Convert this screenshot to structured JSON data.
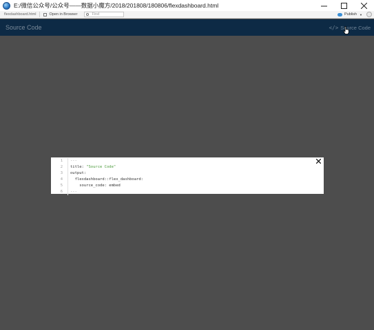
{
  "window": {
    "title": "E:/微信公众号/公众号——数据小魔方/2018/201808/180806/flexdashboard.html",
    "controls": {
      "minimize": "─",
      "close": "✕"
    }
  },
  "toolbar": {
    "file_tab": "flexdashboard.html",
    "open_in_browser": "Open in Browser",
    "find_placeholder": "Find",
    "publish": "Publish"
  },
  "navbar": {
    "title": "Source Code",
    "source_code_link": "Source Code",
    "source_code_glyph": "</>"
  },
  "modal": {
    "close_glyph": "✕",
    "code_lines": [
      {
        "num": "1",
        "parts": [
          {
            "t": "---",
            "cls": "c-dim"
          }
        ]
      },
      {
        "num": "2",
        "parts": [
          {
            "t": "title: ",
            "cls": ""
          },
          {
            "t": "\"Source Code\"",
            "cls": "c-str"
          }
        ]
      },
      {
        "num": "3",
        "parts": [
          {
            "t": "output:",
            "cls": ""
          }
        ]
      },
      {
        "num": "4",
        "parts": [
          {
            "t": "  flexdashboard::flex_dashboard:",
            "cls": ""
          }
        ]
      },
      {
        "num": "5",
        "parts": [
          {
            "t": "    source_code: embed",
            "cls": ""
          }
        ]
      },
      {
        "num": "6",
        "parts": [
          {
            "t": "---",
            "cls": "c-dim"
          }
        ]
      }
    ]
  },
  "colors": {
    "navbar_bg": "#0d2a45",
    "page_bg": "#4d4d4d",
    "string_green": "#4a9a3a"
  }
}
